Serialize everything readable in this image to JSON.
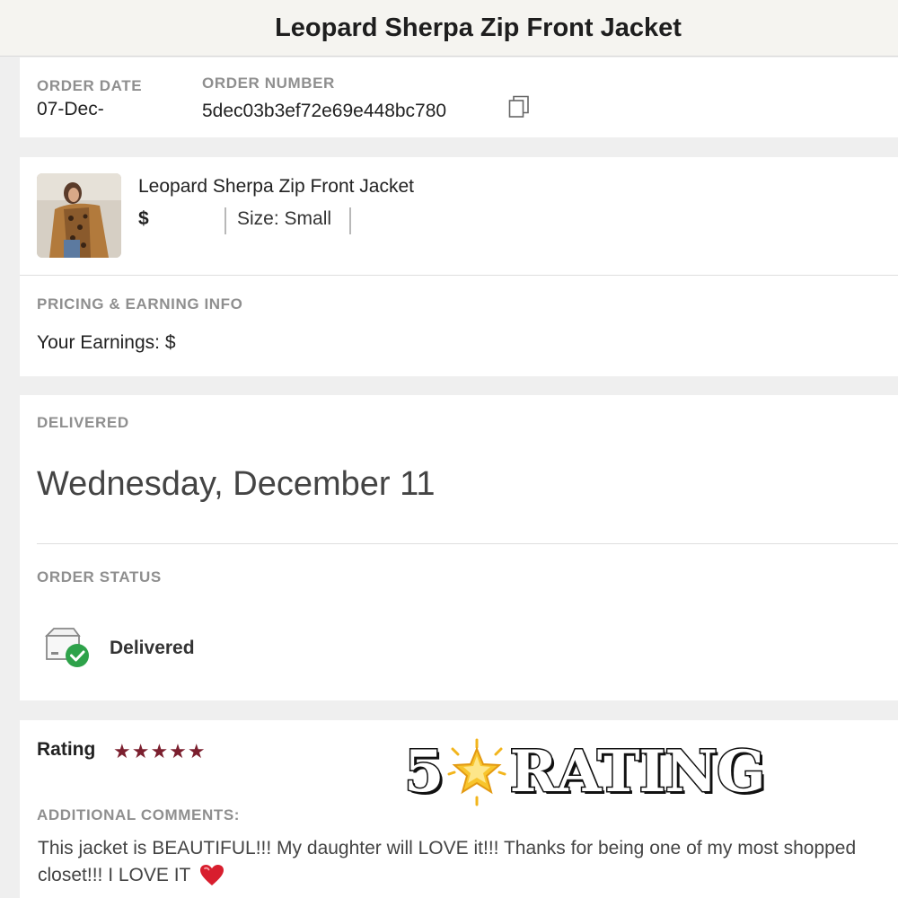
{
  "header": {
    "title": "Leopard Sherpa Zip Front Jacket"
  },
  "order": {
    "date_label": "ORDER DATE",
    "date_value": "07-Dec-",
    "number_label": "ORDER NUMBER",
    "number_value": "5dec03b3ef72e69e448bc780",
    "copy_icon": "copy-icon"
  },
  "product": {
    "name": "Leopard Sherpa Zip Front Jacket",
    "price": "$",
    "size": "Size: Small",
    "image_icon": "product-thumbnail"
  },
  "pricing": {
    "label": "PRICING & EARNING INFO",
    "earnings": "Your Earnings: $"
  },
  "delivery": {
    "label": "DELIVERED",
    "date": "Wednesday, December 11"
  },
  "status": {
    "label": "ORDER STATUS",
    "value": "Delivered",
    "icon": "package-delivered-icon"
  },
  "rating": {
    "label": "Rating",
    "stars": 5,
    "stars_text": "★★★★★",
    "overlay_number": "5",
    "overlay_text": "RATING",
    "overlay_icon": "glowing-star-icon",
    "comments_label": "ADDITIONAL COMMENTS:",
    "comment": "This jacket is BEAUTIFUL!!! My daughter will LOVE it!!! Thanks for being one of my most shopped closet!!! I LOVE IT",
    "comment_icon": "red-heart-icon"
  },
  "colors": {
    "star": "#7b1f2e",
    "check_green": "#2ea24a",
    "heart_red": "#d81e2e",
    "label_gray": "#8f8f8f"
  }
}
